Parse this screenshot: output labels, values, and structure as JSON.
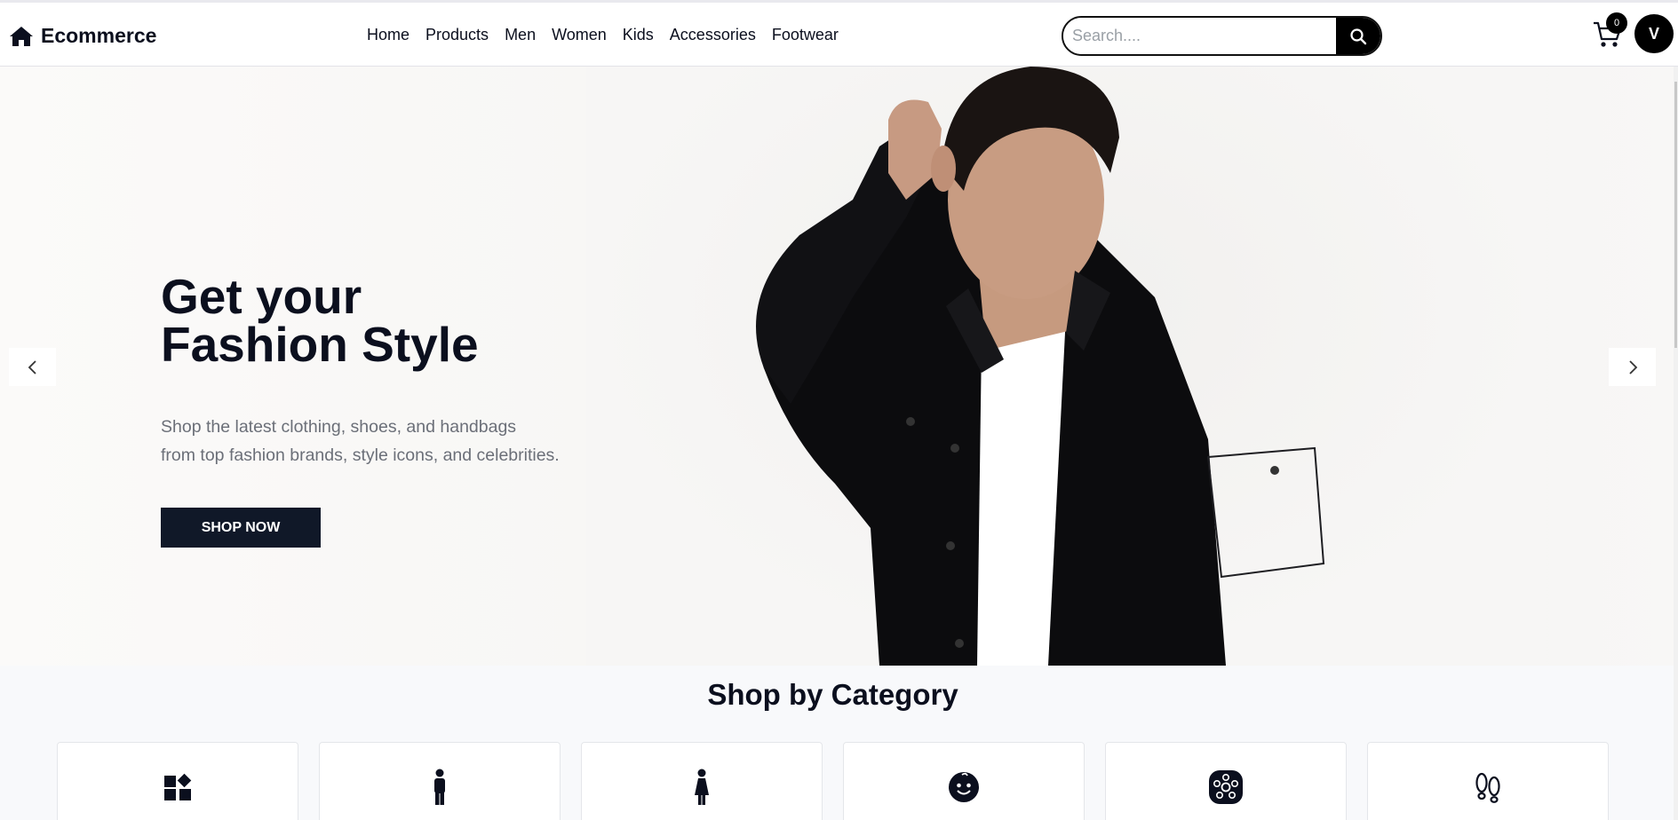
{
  "header": {
    "brand": "Ecommerce",
    "nav": [
      "Home",
      "Products",
      "Men",
      "Women",
      "Kids",
      "Accessories",
      "Footwear"
    ],
    "search_placeholder": "Search....",
    "cart_count": "0",
    "avatar_initial": "V"
  },
  "hero": {
    "title_line1": "Get your",
    "title_line2": "Fashion Style",
    "subtitle_line1": "Shop the latest clothing, shoes, and handbags",
    "subtitle_line2": "from top fashion brands, style icons, and celebrities.",
    "button": "SHOP NOW"
  },
  "category": {
    "title": "Shop by Category",
    "items": [
      {
        "icon": "grid-icon"
      },
      {
        "icon": "man-icon"
      },
      {
        "icon": "woman-icon"
      },
      {
        "icon": "baby-face-icon"
      },
      {
        "icon": "accessories-icon"
      },
      {
        "icon": "footprints-icon"
      }
    ]
  },
  "colors": {
    "primary": "#101828",
    "text": "#0b0f1e",
    "muted": "#6b6f78"
  }
}
